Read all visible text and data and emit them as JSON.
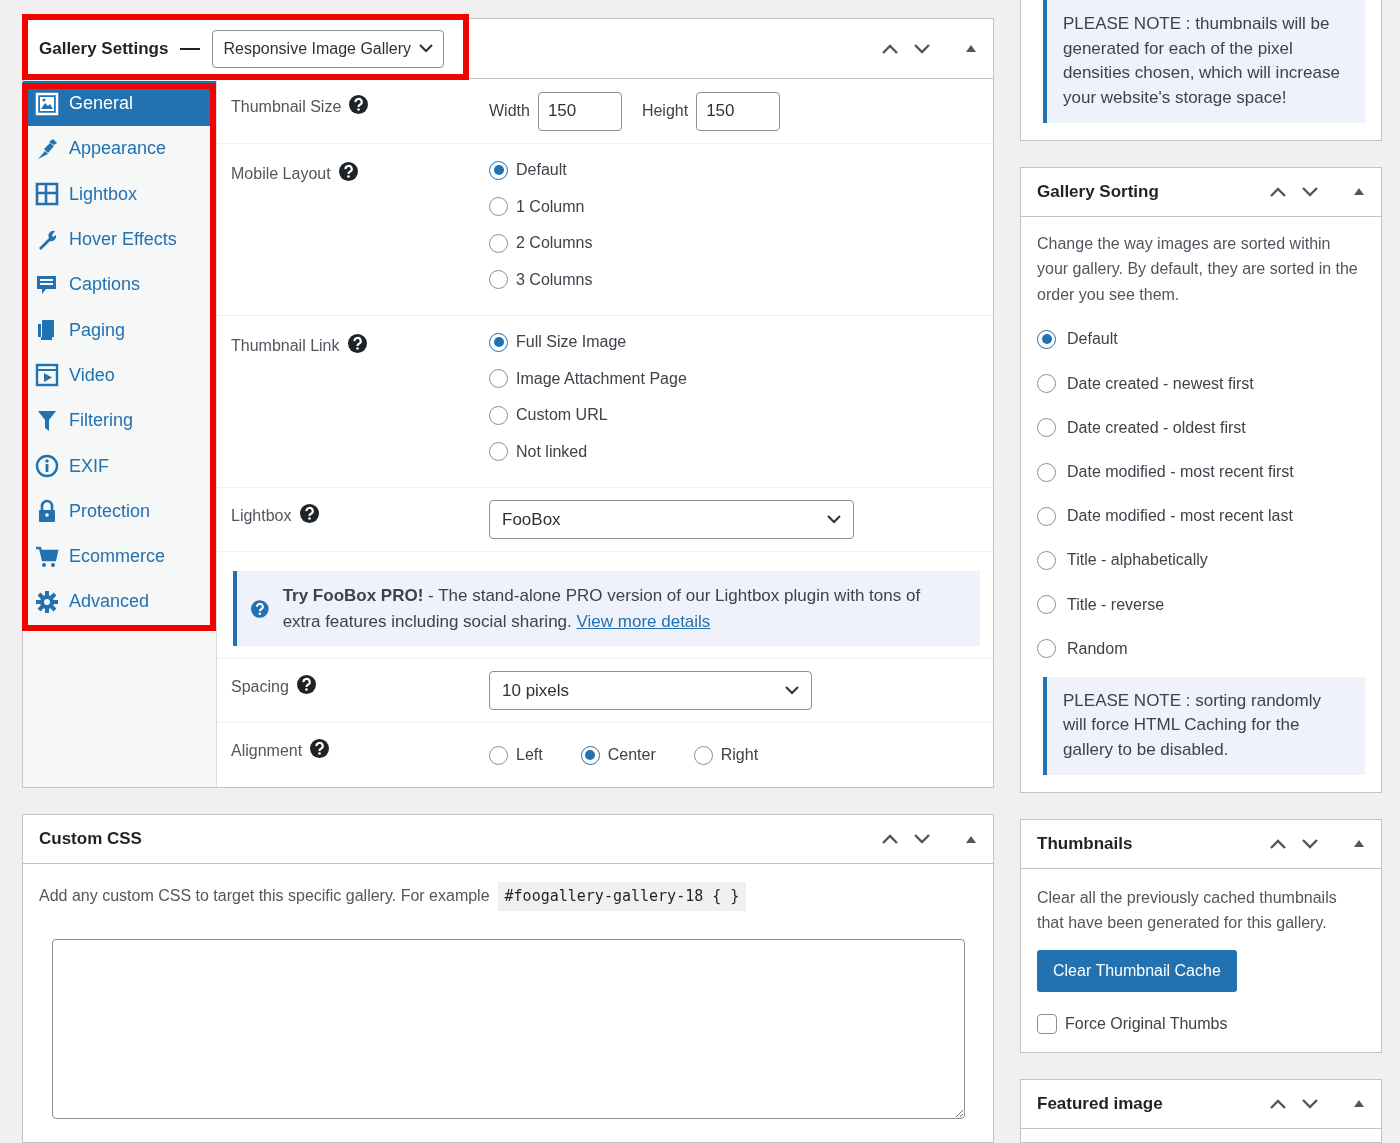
{
  "gallery_settings": {
    "title": "Gallery Settings",
    "template": "Responsive Image Gallery",
    "tabs": [
      {
        "label": "General",
        "selected": true
      },
      {
        "label": "Appearance",
        "selected": false
      },
      {
        "label": "Lightbox",
        "selected": false
      },
      {
        "label": "Hover Effects",
        "selected": false
      },
      {
        "label": "Captions",
        "selected": false
      },
      {
        "label": "Paging",
        "selected": false
      },
      {
        "label": "Video",
        "selected": false
      },
      {
        "label": "Filtering",
        "selected": false
      },
      {
        "label": "EXIF",
        "selected": false
      },
      {
        "label": "Protection",
        "selected": false
      },
      {
        "label": "Ecommerce",
        "selected": false
      },
      {
        "label": "Advanced",
        "selected": false
      }
    ],
    "fields": [
      {
        "kind": "size",
        "label": "Thumbnail Size",
        "width_label": "Width",
        "width_value": "150",
        "height_label": "Height",
        "height_value": "150"
      },
      {
        "kind": "radios",
        "label": "Mobile Layout",
        "options": [
          {
            "label": "Default",
            "selected": true
          },
          {
            "label": "1 Column",
            "selected": false
          },
          {
            "label": "2 Columns",
            "selected": false
          },
          {
            "label": "3 Columns",
            "selected": false
          }
        ]
      },
      {
        "kind": "radios",
        "label": "Thumbnail Link",
        "options": [
          {
            "label": "Full Size Image",
            "selected": true
          },
          {
            "label": "Image Attachment Page",
            "selected": false
          },
          {
            "label": "Custom URL",
            "selected": false
          },
          {
            "label": "Not linked",
            "selected": false
          }
        ]
      },
      {
        "kind": "select",
        "label": "Lightbox",
        "value": "FooBox",
        "wide": true
      },
      {
        "kind": "notice",
        "text": "**Try FooBox PRO!** - The stand-alone PRO version of our Lightbox plugin with tons of extra features including social sharing.",
        "link": "View more details"
      },
      {
        "kind": "select",
        "label": "Spacing",
        "value": "10 pixels",
        "wide": false
      },
      {
        "kind": "inline_radios",
        "label": "Alignment",
        "options": [
          {
            "label": "Left",
            "selected": false
          },
          {
            "label": "Center",
            "selected": true
          },
          {
            "label": "Right",
            "selected": false
          }
        ]
      }
    ]
  },
  "custom_css": {
    "title": "Custom CSS",
    "description": "Add any custom CSS to target this specific gallery. For example",
    "code": "#foogallery-gallery-18 { }"
  },
  "retina_note": "PLEASE NOTE : thumbnails will be generated for each of the pixel densities chosen, which will increase your website's storage space!",
  "gallery_sorting": {
    "title": "Gallery Sorting",
    "description": "Change the way images are sorted within your gallery. By default, they are sorted in the order you see them.",
    "options": [
      {
        "label": "Default",
        "selected": true
      },
      {
        "label": "Date created - newest first",
        "selected": false
      },
      {
        "label": "Date created - oldest first",
        "selected": false
      },
      {
        "label": "Date modified - most recent first",
        "selected": false
      },
      {
        "label": "Date modified - most recent last",
        "selected": false
      },
      {
        "label": "Title - alphabetically",
        "selected": false
      },
      {
        "label": "Title - reverse",
        "selected": false
      },
      {
        "label": "Random",
        "selected": false
      }
    ],
    "note": "PLEASE NOTE : sorting randomly will force HTML Caching for the gallery to be disabled."
  },
  "thumbnails": {
    "title": "Thumbnails",
    "description": "Clear all the previously cached thumbnails that have been generated for this gallery.",
    "button": "Clear Thumbnail Cache",
    "checkbox": {
      "label": "Force Original Thumbs",
      "checked": false
    }
  },
  "featured_image": {
    "title": "Featured image"
  }
}
